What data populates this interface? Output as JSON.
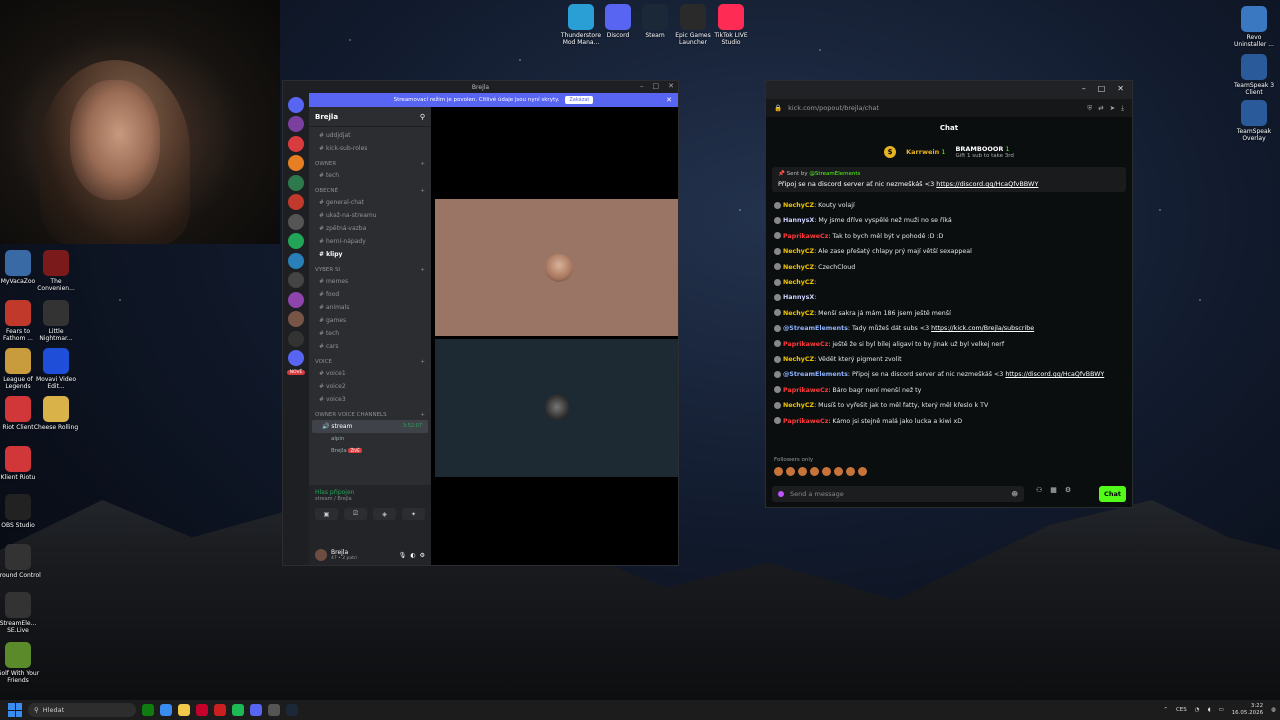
{
  "desktop": {
    "top_icons": [
      {
        "label": "Thunderstore Mod Mana...",
        "icon": "thunderstore-icon",
        "color": "#2a9fd6"
      },
      {
        "label": "Discord",
        "icon": "discord-icon",
        "color": "#5865f2"
      },
      {
        "label": "Steam",
        "icon": "steam-icon",
        "color": "#1b2838"
      },
      {
        "label": "Epic Games Launcher",
        "icon": "epic-icon",
        "color": "#2a2a2a"
      },
      {
        "label": "TikTok LIVE Studio",
        "icon": "tiktok-icon",
        "color": "#fe2c55"
      }
    ],
    "right_icons": [
      {
        "label": "Revo Uninstaller ...",
        "icon": "revo-icon",
        "color": "#3a78c2"
      },
      {
        "label": "TeamSpeak 3 Client",
        "icon": "teamspeak-icon",
        "color": "#2a5a9a"
      },
      {
        "label": "TeamSpeak Overlay",
        "icon": "teamspeak-overlay-icon",
        "color": "#2a5a9a"
      }
    ],
    "left_icons": [
      {
        "label": "MyVacaZoo",
        "icon": "game-icon",
        "color": "#3a6aa5"
      },
      {
        "label": "The Convenien...",
        "icon": "game-icon",
        "color": "#7a1a1a"
      },
      {
        "label": "Fears to Fathom ...",
        "icon": "game-icon",
        "color": "#c0392b"
      },
      {
        "label": "Little Nightmar...",
        "icon": "game-icon",
        "color": "#333"
      },
      {
        "label": "League of Legends",
        "icon": "lol-icon",
        "color": "#c89b3c"
      },
      {
        "label": "Movavi Video Edit...",
        "icon": "movavi-icon",
        "color": "#1f4fd8"
      },
      {
        "label": "Riot Client",
        "icon": "riot-icon",
        "color": "#d13639"
      },
      {
        "label": "Cheese Rolling",
        "icon": "cheese-icon",
        "color": "#d9b34a"
      },
      {
        "label": "Klient Riotu",
        "icon": "riot-icon",
        "color": "#d13639"
      },
      {
        "label": "OBS Studio",
        "icon": "obs-icon",
        "color": "#222"
      },
      {
        "label": "Ground Control",
        "icon": "game-icon",
        "color": "#333"
      },
      {
        "label": "StreamEle... SE.Live",
        "icon": "streamelements-icon",
        "color": "#333"
      },
      {
        "label": "Golf With Your Friends",
        "icon": "golf-icon",
        "color": "#5a8a2a"
      }
    ]
  },
  "discord": {
    "title": "Brejla",
    "banner_text": "Streamovací režim je povolen. Citlivé údaje jsou nyní skryty.",
    "banner_button": "Zakázat",
    "server_name": "Brejla",
    "channels_top": [
      "uddjdjat",
      "kick-sub-roles"
    ],
    "categories": [
      {
        "name": "OWNER",
        "channels": [
          "tech"
        ]
      },
      {
        "name": "OBECNÉ",
        "channels": [
          "general-chat",
          "ukaž-na-streamu",
          "zpětná-vazba",
          "herní-nápady",
          "klipy"
        ]
      },
      {
        "name": "VYBER SI",
        "channels": [
          "memes",
          "food",
          "animals",
          "games",
          "tech",
          "cars"
        ]
      },
      {
        "name": "VOICE",
        "channels": [
          "voice1",
          "voice2",
          "voice3"
        ]
      },
      {
        "name": "OWNER VOICE CHANNELS",
        "channels": []
      }
    ],
    "voice_channel": {
      "name": "stream",
      "time": "3:52:07"
    },
    "voice_users": [
      "alpin",
      "Brejla"
    ],
    "live_badge": "ŽIVĚ",
    "voice_panel": {
      "status": "Hlas připojen",
      "sub": "stream / Brejla"
    },
    "user": {
      "name": "Brejla",
      "status": "47 • 2 patri"
    },
    "new_badge": "NOVÉ"
  },
  "kick": {
    "url": "kick.com/popout/brejla/chat",
    "title": "Chat",
    "gift": {
      "user1": "Karrwein",
      "user1_count": "1",
      "user2": "BRAMBOOOR",
      "user2_count": "1",
      "sub": "Gift 1 sub to take 3rd"
    },
    "pinned": {
      "sent_by": "Sent by",
      "author": "@StreamElements",
      "text": "Připoj se na discord server ať nic nezmeškáš <3 ",
      "link": "https://discord.gg/HcaQfvBBWY"
    },
    "messages": [
      {
        "user": "NechyCZ",
        "color": "#f2c500",
        "text": ": Kouty volají"
      },
      {
        "user": "HannysX",
        "color": "#cfd3ff",
        "text": ": My jsme dříve vyspělé než muži no se říká"
      },
      {
        "user": "PaprikaweCz",
        "color": "#ff3a3a",
        "text": ": Tak to bych měl být v pohodě :D :D"
      },
      {
        "user": "NechyCZ",
        "color": "#f2c500",
        "text": ": Ale zase přešatý chlapy prý mají větší sexappeal"
      },
      {
        "user": "NechyCZ",
        "color": "#f2c500",
        "text": ": CzechCloud"
      },
      {
        "user": "NechyCZ",
        "color": "#f2c500",
        "text": ":"
      },
      {
        "user": "HannysX",
        "color": "#cfd3ff",
        "text": ":"
      },
      {
        "user": "NechyCZ",
        "color": "#f2c500",
        "text": ": Menší  sakra já mám 186  jsem ještě menší"
      },
      {
        "user": "@StreamElements",
        "color": "#8fb3ff",
        "text": ": Tady můžeš dát subs <3 ",
        "link": "https://kick.com/Brejla/subscribe"
      },
      {
        "user": "PaprikaweCz",
        "color": "#ff3a3a",
        "text": ": ještě že si byl bílej aligaví to by jinak už byl velkej nerf"
      },
      {
        "user": "NechyCZ",
        "color": "#f2c500",
        "text": ": Vědět který pigment zvolit"
      },
      {
        "user": "@StreamElements",
        "color": "#8fb3ff",
        "text": ": Připoj se na discord server ať nic nezmeškáš <3 ",
        "link": "https://discord.gg/HcaQfvBBWY"
      },
      {
        "user": "PaprikaweCz",
        "color": "#ff3a3a",
        "text": ": Báro bagr není menší než ty"
      },
      {
        "user": "NechyCZ",
        "color": "#f2c500",
        "text": ": Musíš to vyřešit jak to měl fatty, který měl křeslo k TV"
      },
      {
        "user": "PaprikaweCz",
        "color": "#ff3a3a",
        "text": ": Kámo jsi stejně malá jako lucka a kiwi xD"
      }
    ],
    "followers_only": "Followers only",
    "input_placeholder": "Send a message",
    "send_label": "Chat"
  },
  "taskbar": {
    "search_placeholder": "Hledat",
    "lang": "CES",
    "time": "3:22",
    "date": "16.05.2026"
  }
}
